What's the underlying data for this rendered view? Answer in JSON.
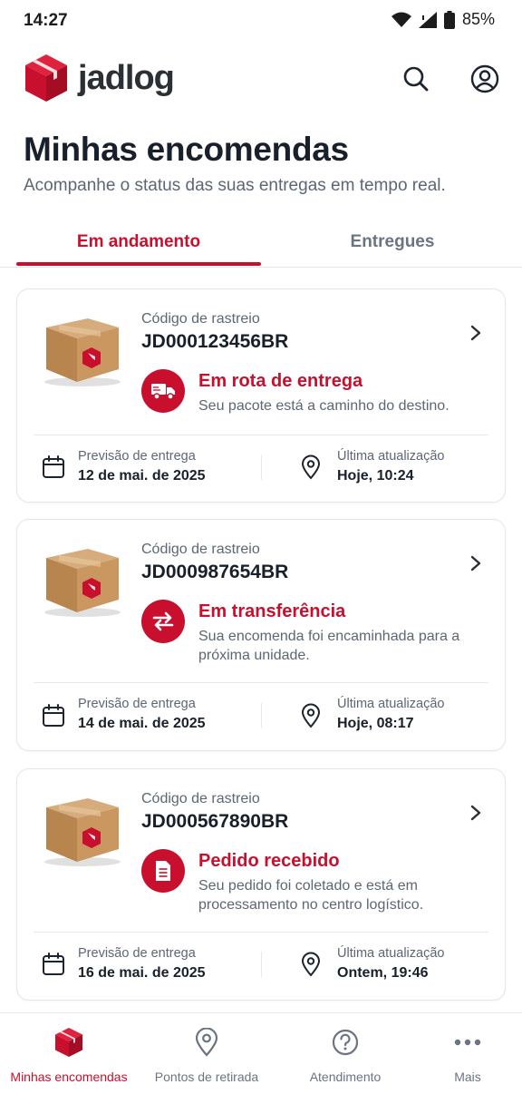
{
  "status_bar": {
    "time": "14:27",
    "battery": "85%"
  },
  "brand": {
    "name": "jadlog",
    "accent": "#c8102e"
  },
  "header": {
    "search_icon": "search-icon",
    "account_icon": "account-icon"
  },
  "page": {
    "title": "Minhas encomendas",
    "subtitle": "Acompanhe o status das suas entregas em tempo real."
  },
  "tabs": [
    {
      "label": "Em andamento",
      "active": true
    },
    {
      "label": "Entregues",
      "active": false
    }
  ],
  "shipments": [
    {
      "code_label": "Código de rastreio",
      "code": "JD000123456BR",
      "status_icon": "truck-icon",
      "status_title": "Em rota de entrega",
      "status_desc": "Seu pacote está a caminho do destino.",
      "eta_label": "Previsão de entrega",
      "eta_value": "12 de mai. de 2025",
      "update_label": "Última atualização",
      "update_value": "Hoje, 10:24"
    },
    {
      "code_label": "Código de rastreio",
      "code": "JD000987654BR",
      "status_icon": "transfer-icon",
      "status_title": "Em transferência",
      "status_desc": "Sua encomenda foi encaminhada para a próxima unidade.",
      "eta_label": "Previsão de entrega",
      "eta_value": "14 de mai. de 2025",
      "update_label": "Última atualização",
      "update_value": "Hoje, 08:17"
    },
    {
      "code_label": "Código de rastreio",
      "code": "JD000567890BR",
      "status_icon": "document-icon",
      "status_title": "Pedido recebido",
      "status_desc": "Seu pedido foi coletado e está em processamento no centro logístico.",
      "eta_label": "Previsão de entrega",
      "eta_value": "16 de mai. de 2025",
      "update_label": "Última atualização",
      "update_value": "Ontem, 19:46"
    }
  ],
  "bottom_nav": [
    {
      "label": "Minhas encomendas",
      "icon": "box-icon",
      "active": true
    },
    {
      "label": "Pontos de retirada",
      "icon": "location-pin-icon",
      "active": false
    },
    {
      "label": "Atendimento",
      "icon": "help-icon",
      "active": false
    },
    {
      "label": "Mais",
      "icon": "more-icon",
      "active": false
    }
  ]
}
